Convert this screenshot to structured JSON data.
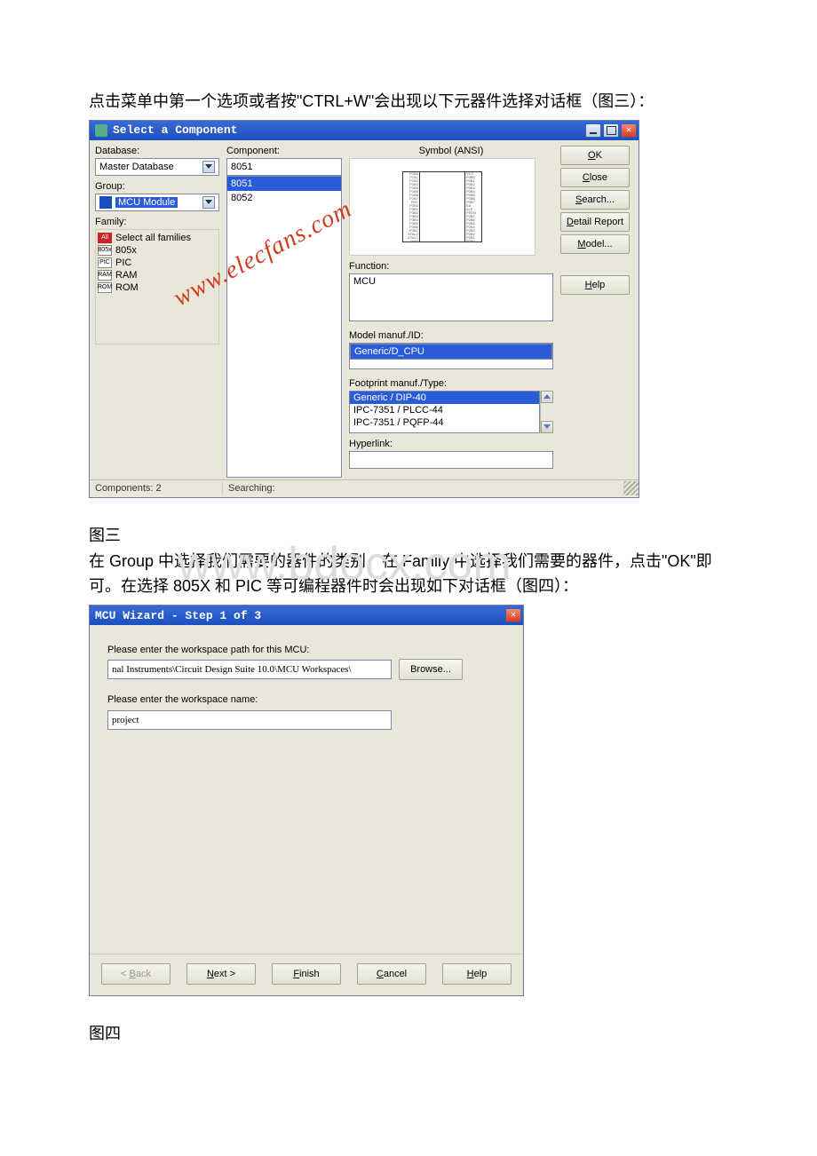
{
  "doc": {
    "para1": "点击菜单中第一个选项或者按\"CTRL+W\"会出现以下元器件选择对话框（图三）：",
    "fig3_caption": "图三",
    "para2": "在 Group 中选择我们需要的器件的类别，在 Family 中选择我们需要的器件，点击\"OK\"即可。在选择 805X 和 PIC 等可编程器件时会出现如下对话框（图四）：",
    "fig4_caption": "图四"
  },
  "watermark1": "www.elecfans.com",
  "watermark2": "www.bdocx.com",
  "dlg1": {
    "title": "Select a Component",
    "labels": {
      "database": "Database:",
      "group": "Group:",
      "family": "Family:",
      "component": "Component:",
      "symbol": "Symbol (ANSI)",
      "function": "Function:",
      "model": "Model manuf./ID:",
      "footprint": "Footprint manuf./Type:",
      "hyperlink": "Hyperlink:"
    },
    "database_value": "Master Database",
    "group_value": "MCU Module",
    "component_input": "8051",
    "component_list": [
      "8051",
      "8052"
    ],
    "family_items": [
      {
        "chip": "All",
        "label": "Select all families",
        "all": true
      },
      {
        "chip": "805x",
        "label": "805x"
      },
      {
        "chip": "PIC",
        "label": "PIC"
      },
      {
        "chip": "RAM",
        "label": "RAM"
      },
      {
        "chip": "ROM",
        "label": "ROM"
      }
    ],
    "function_value": "MCU",
    "model_value": "Generic/D_CPU",
    "footprints": [
      "Generic / DIP-40",
      "IPC-7351 / PLCC-44",
      "IPC-7351 / PQFP-44"
    ],
    "hyperlink_value": "",
    "chip_pins_left": [
      "P1B0",
      "P1B1",
      "P1B2",
      "P1B3",
      "P1B4",
      "P1B5",
      "P1B6",
      "P1B7",
      "RST",
      "P3B0",
      "P3B1",
      "P3B2",
      "P3B3",
      "P3B4",
      "P3B5",
      "P3B6",
      "P3B7",
      "XTAL2",
      "XTAL1",
      "GND"
    ],
    "chip_pins_right": [
      "VCC",
      "P0B0",
      "P0B1",
      "P0B2",
      "P0B3",
      "P0B4",
      "P0B5",
      "P0B6",
      "P0B7",
      "EA",
      "ALE",
      "PSEN",
      "P2B7",
      "P2B6",
      "P2B5",
      "P2B4",
      "P2B3",
      "P2B2",
      "P2B1",
      "P2B0"
    ],
    "buttons": {
      "ok": "OK",
      "close": "Close",
      "search": "Search...",
      "detail": "Detail Report",
      "model": "Model...",
      "help": "Help"
    },
    "status": {
      "components": "Components: 2",
      "searching": "Searching:"
    }
  },
  "dlg2": {
    "title": "MCU Wizard - Step 1 of 3",
    "label_path": "Please enter the workspace path for this MCU:",
    "path_value": "nal Instruments\\Circuit Design Suite 10.0\\MCU Workspaces\\",
    "browse": "Browse...",
    "label_name": "Please enter the workspace name:",
    "name_value": "project",
    "btn_back": "< Back",
    "btn_next": "Next >",
    "btn_finish": "Finish",
    "btn_cancel": "Cancel",
    "btn_help": "Help"
  }
}
